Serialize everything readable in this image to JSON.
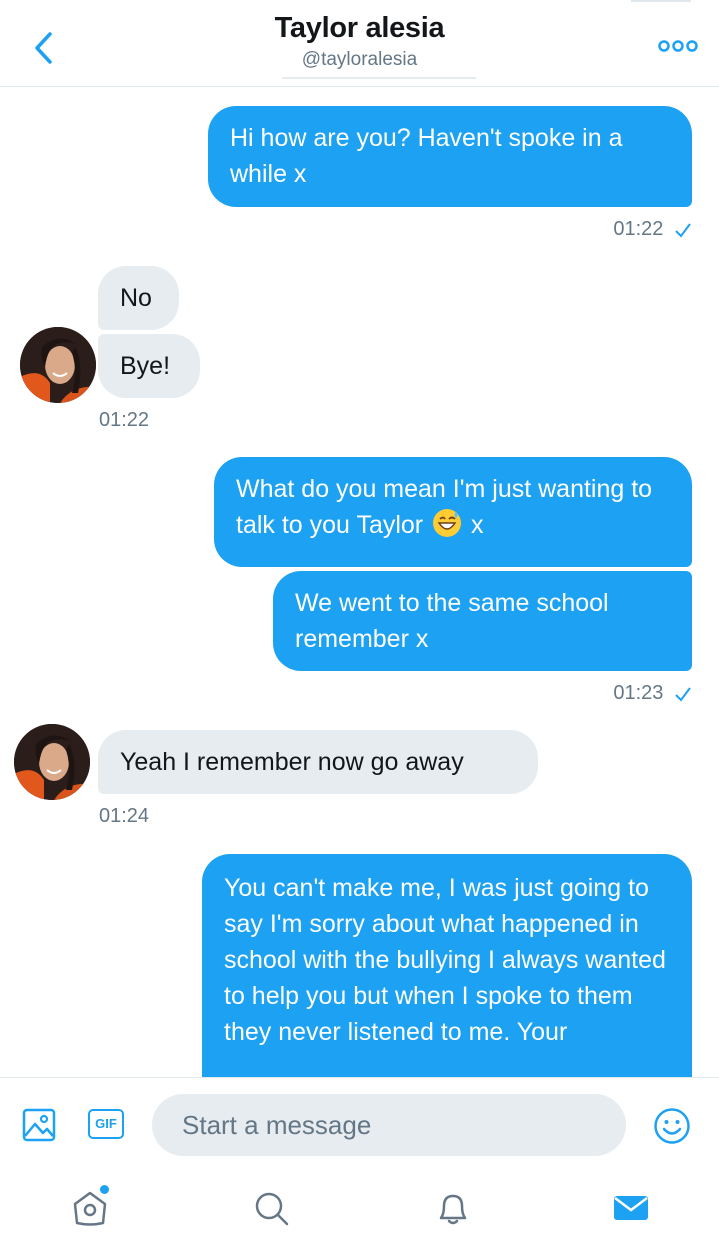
{
  "header": {
    "name": "Taylor alesia",
    "handle": "@tayloralesia"
  },
  "messages": [
    {
      "side": "sent",
      "text": "Hi how are you? Haven't spoke in a while x"
    },
    {
      "side": "meta",
      "time": "01:22"
    },
    {
      "side": "recv",
      "text": "No"
    },
    {
      "side": "recv",
      "text": "Bye!"
    },
    {
      "side": "meta",
      "time": "01:22"
    },
    {
      "side": "sent",
      "text_before_emoji": "What do you mean I'm just wanting to talk to you Taylor",
      "emoji": "grinning-sweat-emoji",
      "text_after_emoji": "x"
    },
    {
      "side": "sent",
      "text": "We went to the same school remember x"
    },
    {
      "side": "meta",
      "time": "01:23"
    },
    {
      "side": "recv",
      "text": "Yeah I remember now go away"
    },
    {
      "side": "meta",
      "time": "01:24"
    },
    {
      "side": "sent",
      "text": "You can't make me, I was just going to say I'm sorry about what happened in school with the bullying I always wanted to help you but when I spoke to them they never listened to me. Your"
    }
  ],
  "composer": {
    "placeholder": "Start a message",
    "gif_label": "GIF"
  },
  "icons": {
    "back": "chevron-left-icon",
    "more": "more-dots-icon",
    "image": "image-icon",
    "emoji": "smiley-icon",
    "home": "home-icon",
    "search": "search-icon",
    "notifications": "bell-icon",
    "messages": "envelope-icon"
  },
  "colors": {
    "accent": "#1da1f2",
    "received_bubble": "#e6ecf0",
    "secondary_text": "#657786"
  }
}
